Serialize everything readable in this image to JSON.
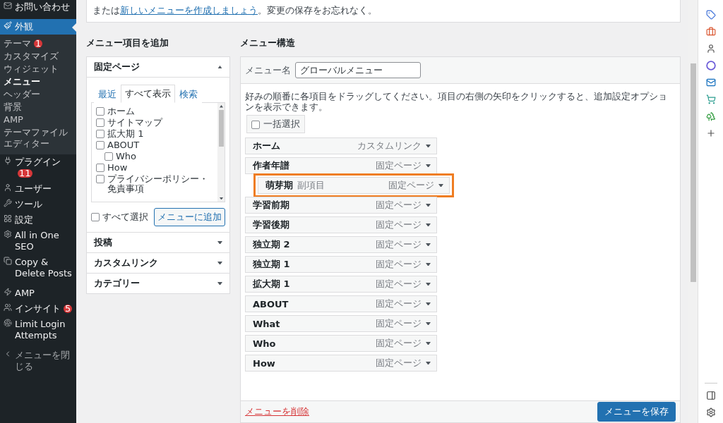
{
  "sidebar": {
    "items": [
      {
        "label": "お問い合わせ",
        "selected": false
      },
      {
        "label": "外観",
        "selected": true,
        "children": [
          {
            "label": "テーマ",
            "badge": "1",
            "selected": false
          },
          {
            "label": "カスタマイズ",
            "selected": false
          },
          {
            "label": "ウィジェット",
            "selected": false
          },
          {
            "label": "メニュー",
            "selected": true
          },
          {
            "label": "ヘッダー",
            "selected": false
          },
          {
            "label": "背景",
            "selected": false
          },
          {
            "label": "AMP",
            "selected": false
          },
          {
            "label": "テーマファイルエディター",
            "selected": false
          }
        ]
      },
      {
        "label": "プラグイン",
        "badge": "11",
        "selected": false
      },
      {
        "label": "ユーザー",
        "selected": false
      },
      {
        "label": "ツール",
        "selected": false
      },
      {
        "label": "設定",
        "selected": false
      },
      {
        "label": "All in One SEO",
        "selected": false
      },
      {
        "label": "Copy & Delete Posts",
        "selected": false
      },
      {
        "label": "AMP",
        "selected": false
      },
      {
        "label": "インサイト",
        "badge": "5",
        "selected": false
      },
      {
        "label": "Limit Login Attempts",
        "selected": false
      }
    ],
    "collapse": "メニューを閉じる"
  },
  "notice": {
    "before": "または",
    "link": "新しいメニューを作成しましょう",
    "after": "。変更の保存をお忘れなく。"
  },
  "add_items": {
    "heading": "メニュー項目を追加",
    "sections": [
      {
        "title": "固定ページ",
        "expanded": true
      },
      {
        "title": "投稿",
        "expanded": false
      },
      {
        "title": "カスタムリンク",
        "expanded": false
      },
      {
        "title": "カテゴリー",
        "expanded": false
      }
    ],
    "tabs": [
      {
        "label": "最近",
        "selected": false
      },
      {
        "label": "すべて表示",
        "selected": true
      },
      {
        "label": "検索",
        "selected": false
      }
    ],
    "pages": [
      {
        "label": "ホーム",
        "checked": false
      },
      {
        "label": "サイトマップ",
        "checked": false
      },
      {
        "label": "拡大期 1",
        "checked": false
      },
      {
        "label": "ABOUT",
        "checked": false,
        "children": [
          {
            "label": "Who",
            "checked": false
          }
        ]
      },
      {
        "label": "How",
        "checked": false
      },
      {
        "label": "プライバシーポリシー・免責事項",
        "checked": false
      }
    ],
    "select_all": {
      "label": "すべて選択",
      "checked": false
    },
    "add_button": "メニューに追加"
  },
  "structure": {
    "heading": "メニュー構造",
    "menu_name": {
      "label": "メニュー名",
      "value": "グローバルメニュー"
    },
    "instructions": "好みの順番に各項目をドラッグしてください。項目の右側の矢印をクリックすると、追加設定オプションを表示できます。",
    "bulk_select": {
      "label": "一括選択",
      "checked": false
    },
    "items": [
      {
        "title": "ホーム",
        "type": "カスタムリンク",
        "highlighted": false
      },
      {
        "title": "作者年譜",
        "type": "固定ページ",
        "highlighted": false,
        "children": [
          {
            "title": "萌芽期",
            "sub_label": "副項目",
            "type": "固定ページ",
            "highlighted": true
          }
        ]
      },
      {
        "title": "学習前期",
        "type": "固定ページ",
        "highlighted": false
      },
      {
        "title": "学習後期",
        "type": "固定ページ",
        "highlighted": false
      },
      {
        "title": "独立期 2",
        "type": "固定ページ",
        "highlighted": false
      },
      {
        "title": "独立期 1",
        "type": "固定ページ",
        "highlighted": false
      },
      {
        "title": "拡大期 1",
        "type": "固定ページ",
        "highlighted": false
      },
      {
        "title": "ABOUT",
        "type": "固定ページ",
        "highlighted": false
      },
      {
        "title": "What",
        "type": "固定ページ",
        "highlighted": false
      },
      {
        "title": "Who",
        "type": "固定ページ",
        "highlighted": false
      },
      {
        "title": "How",
        "type": "固定ページ",
        "highlighted": false
      }
    ],
    "delete_link": "メニューを削除",
    "save_button": "メニューを保存"
  }
}
